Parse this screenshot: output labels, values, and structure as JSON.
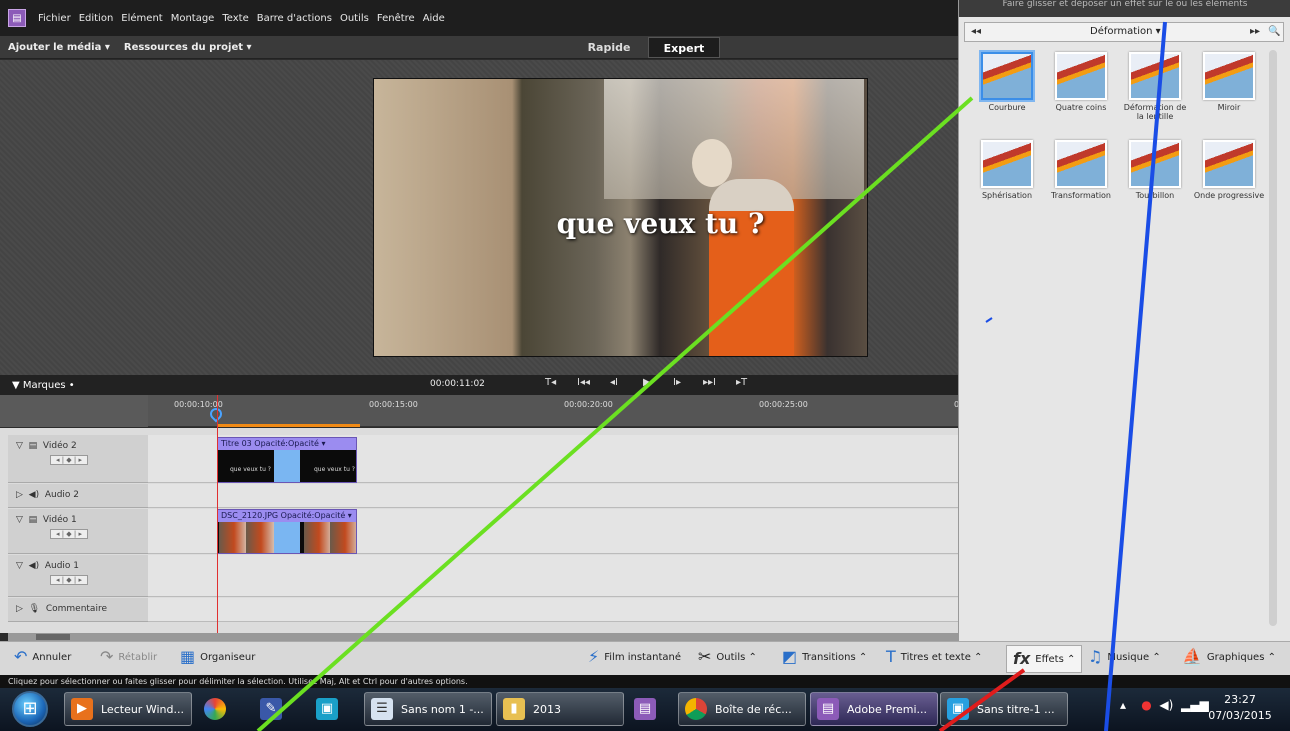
{
  "menubar": {
    "logo": "app-logo",
    "items": [
      "Fichier",
      "Edition",
      "Elément",
      "Montage",
      "Texte",
      "Barre d'actions",
      "Outils",
      "Fenêtre",
      "Aide"
    ]
  },
  "projectbar": {
    "add_media": "Ajouter le média ▾",
    "project_assets": "Ressources du projet ▾",
    "mode_quick": "Rapide",
    "mode_expert": "Expert"
  },
  "preview": {
    "title_text": "que veux tu ?"
  },
  "transport": {
    "marks": "▼ Marques  •",
    "current_time": "00:00:11:02",
    "controls": [
      "T◂",
      "I◂◂",
      "◂I",
      "▶",
      "I▸",
      "▸▸I",
      "▸T"
    ]
  },
  "ruler": {
    "ticks": [
      "00:00:10:00",
      "00:00:15:00",
      "00:00:20:00",
      "00:00:25:00",
      "0"
    ]
  },
  "tracks": [
    {
      "name": "Vidéo 2",
      "ctrl": "◂ | ◆ | ▸"
    },
    {
      "name": "Audio 2"
    },
    {
      "name": "Vidéo 1",
      "ctrl": "◂ | ◆ | ▸"
    },
    {
      "name": "Audio 1",
      "ctrl": "◂ | ◆ | ▸"
    },
    {
      "name": "Commentaire"
    }
  ],
  "clips": {
    "title_clip": "Titre 03  Opacité:Opacité ▾",
    "title_clip_text": "que veux tu ?",
    "photo_clip": "DSC_2120.JPG  Opacité:Opacité ▾"
  },
  "actionbar": {
    "undo": "Annuler",
    "redo": "Rétablir",
    "organizer": "Organiseur",
    "instant_movie": "Film instantané",
    "tools": "Outils  ⌃",
    "transitions": "Transitions  ⌃",
    "titles": "Titres et texte  ⌃",
    "effects": "Effets  ⌃",
    "music": "Musique  ⌃",
    "graphics": "Graphiques  ⌃"
  },
  "status": "Cliquez pour sélectionner ou faites glisser pour délimiter la sélection. Utilisez Maj, Alt et Ctrl pour d'autres options.",
  "effects_panel": {
    "header": "Faire glisser et déposer un effet sur le ou les éléments",
    "category": "Déformation ▾",
    "effects": [
      "Courbure",
      "Quatre coins",
      "Déformation de la lentille",
      "Miroir",
      "Sphérisation",
      "Transformation",
      "Tourbillon",
      "Onde progressive"
    ]
  },
  "taskbar": {
    "items": [
      "Lecteur Wind...",
      "Sans nom 1 -...",
      "2013",
      "Boîte de réc...",
      "Adobe Premi...",
      "Sans titre-1 ..."
    ],
    "time": "23:27",
    "date": "07/03/2015"
  },
  "colors": {
    "accent": "#3b8ee8",
    "annotation_green": "#6be021",
    "annotation_blue": "#1a4de6",
    "annotation_red": "#e01c1c"
  }
}
